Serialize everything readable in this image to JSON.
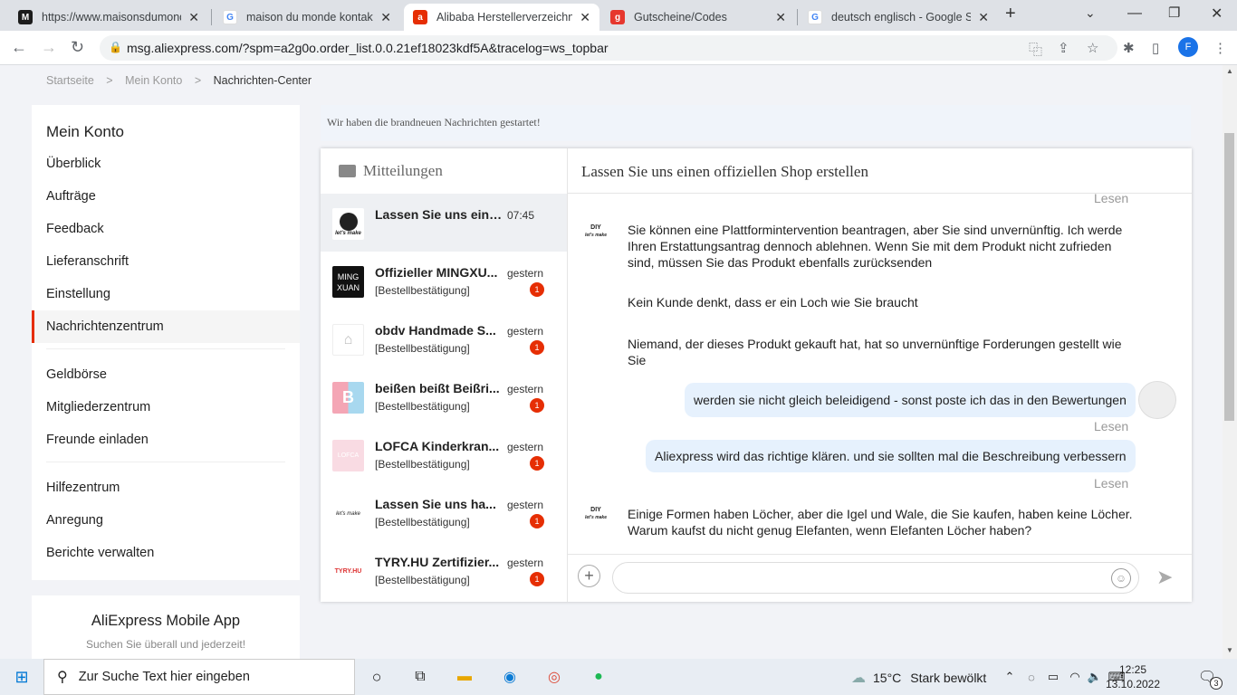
{
  "browser": {
    "tabs": [
      {
        "title": "https://www.maisonsdumonde",
        "favicon": "M",
        "color": "#1c1c1c"
      },
      {
        "title": "maison du monde kontakt - G",
        "favicon": "G",
        "color": "#4285f4"
      },
      {
        "title": "Alibaba Herstellerverzeichnis",
        "favicon": "a",
        "color": "#e62e04"
      },
      {
        "title": "Gutscheine/Codes",
        "favicon": "g",
        "color": "#e6372e"
      },
      {
        "title": "deutsch englisch - Google S",
        "favicon": "G",
        "color": "#4285f4"
      }
    ],
    "new_tab": "+",
    "url": "msg.aliexpress.com/?spm=a2g0o.order_list.0.0.21ef18023kdf5A&tracelog=ws_topbar",
    "profile_initial": "F"
  },
  "breadcrumb": {
    "home": "Startseite",
    "sep": ">",
    "account": "Mein Konto",
    "current": "Nachrichten-Center"
  },
  "sidebar": {
    "title": "Mein Konto",
    "group1": [
      "Überblick",
      "Aufträge",
      "Feedback",
      "Lieferanschrift",
      "Einstellung",
      "Nachrichtenzentrum"
    ],
    "group2": [
      "Geldbörse",
      "Mitgliederzentrum",
      "Freunde einladen"
    ],
    "group3": [
      "Hilfezentrum",
      "Anregung",
      "Berichte verwalten"
    ]
  },
  "app_promo": {
    "title": "AliExpress Mobile App",
    "subtitle": "Suchen Sie überall und jederzeit!"
  },
  "notice": "Wir haben die brandneuen Nachrichten gestartet!",
  "messages_header": "Mitteilungen",
  "conversations": [
    {
      "name": "Lassen Sie uns eine...",
      "time": "07:45",
      "sub": "",
      "badge": "",
      "avatar": "DIY let's make",
      "avatar_bg": "#ffffff"
    },
    {
      "name": "Offizieller MINGXU...",
      "time": "gestern",
      "sub": "[Bestellbestätigung]",
      "badge": "1",
      "avatar": "MING XUAN",
      "avatar_bg": "#111111"
    },
    {
      "name": "obdv Handmade S...",
      "time": "gestern",
      "sub": "[Bestellbestätigung]",
      "badge": "1",
      "avatar": "store",
      "avatar_bg": "#ffffff"
    },
    {
      "name": "beißen beißt Beißri...",
      "time": "gestern",
      "sub": "[Bestellbestätigung]",
      "badge": "1",
      "avatar": "B",
      "avatar_bg": "#ffffff"
    },
    {
      "name": "LOFCA Kinderkran...",
      "time": "gestern",
      "sub": "[Bestellbestätigung]",
      "badge": "1",
      "avatar": "LOFCA",
      "avatar_bg": "#f9dbe3"
    },
    {
      "name": "Lassen Sie uns ha...",
      "time": "gestern",
      "sub": "[Bestellbestätigung]",
      "badge": "1",
      "avatar": "let's make",
      "avatar_bg": "#ffffff"
    },
    {
      "name": "TYRY.HU Zertifizier...",
      "time": "gestern",
      "sub": "[Bestellbestätigung]",
      "badge": "1",
      "avatar": "TYRY.HU",
      "avatar_bg": "#ffffff"
    }
  ],
  "chat": {
    "title": "Lassen Sie uns einen offiziellen Shop erstellen",
    "read_label": "Lesen",
    "seller_msg1": "Sie können eine Plattformintervention beantragen, aber Sie sind unvernünftig. Ich werde Ihren Erstattungsantrag dennoch ablehnen. Wenn Sie mit dem Produkt nicht zufrieden sind, müssen Sie das Produkt ebenfalls zurücksenden",
    "seller_msg2": "Kein Kunde denkt, dass er ein Loch wie Sie braucht",
    "seller_msg3": "Niemand, der dieses Produkt gekauft hat, hat so unvernünftige Forderungen gestellt wie Sie",
    "user_msg1": "werden sie nicht gleich beleidigend - sonst poste ich das in den Bewertungen",
    "user_msg2": "Aliexpress wird das richtige klären. und sie sollten mal die Beschreibung verbessern",
    "seller_msg4": "Einige Formen haben Löcher, aber die Igel und Wale, die Sie kaufen, haben keine Löcher. Warum kaufst du nicht genug Elefanten, wenn Elefanten Löcher haben?",
    "seller_avatar_top": "DIY",
    "seller_avatar_bottom": "let's make",
    "input_value": ""
  },
  "taskbar": {
    "search_placeholder": "Zur Suche Text hier eingeben",
    "weather_temp": "15°C",
    "weather_text": "Stark bewölkt",
    "time": "12:25",
    "date": "13.10.2022",
    "notif_count": "3"
  }
}
